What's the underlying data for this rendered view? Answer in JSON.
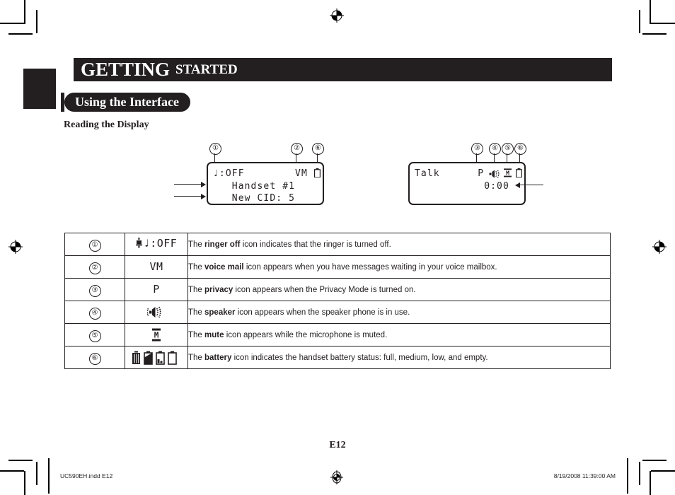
{
  "header": {
    "chapter_main": "GETTING",
    "chapter_sub": "STARTED",
    "section_pill": "Using the Interface",
    "subheading": "Reading the Display"
  },
  "display_left": {
    "line1": "♩:OFF        VM",
    "line2": "   Handset #1",
    "line3": "   New CID: 5",
    "callouts": [
      "①",
      "②",
      "⑥"
    ]
  },
  "display_right": {
    "line1": "Talk      P",
    "line2": "           0:00",
    "callouts": [
      "③",
      "④",
      "⑤",
      "⑥"
    ]
  },
  "table": {
    "rows": [
      {
        "num": "①",
        "icon_name": "ringer-off-icon",
        "icon_text": "♩:OFF",
        "desc_pre": "The ",
        "desc_bold": "ringer off",
        "desc_post": " icon indicates that the ringer is turned off."
      },
      {
        "num": "②",
        "icon_name": "voice-mail-icon",
        "icon_text": "VM",
        "desc_pre": "The ",
        "desc_bold": "voice mail",
        "desc_post": " icon appears when you have messages waiting in your voice mailbox."
      },
      {
        "num": "③",
        "icon_name": "privacy-icon",
        "icon_text": "P",
        "desc_pre": "The ",
        "desc_bold": "privacy",
        "desc_post": " icon appears when the Privacy Mode is turned on."
      },
      {
        "num": "④",
        "icon_name": "speaker-icon",
        "icon_text": "",
        "desc_pre": "The ",
        "desc_bold": "speaker",
        "desc_post": " icon appears when the speaker phone is in use."
      },
      {
        "num": "⑤",
        "icon_name": "mute-icon",
        "icon_text": "",
        "desc_pre": "The ",
        "desc_bold": "mute",
        "desc_post": " icon appears while the microphone is muted."
      },
      {
        "num": "⑥",
        "icon_name": "battery-icon",
        "icon_text": "",
        "desc_pre": "The ",
        "desc_bold": "battery",
        "desc_post": " icon indicates the handset battery status: full, medium, low, and empty."
      }
    ]
  },
  "footer": {
    "page_number": "E12",
    "file_info": "UC590EH.indd   E12",
    "timestamp": "8/19/2008   11:39:00 AM"
  },
  "colors": {
    "ink": "#231f20",
    "paper": "#ffffff"
  }
}
